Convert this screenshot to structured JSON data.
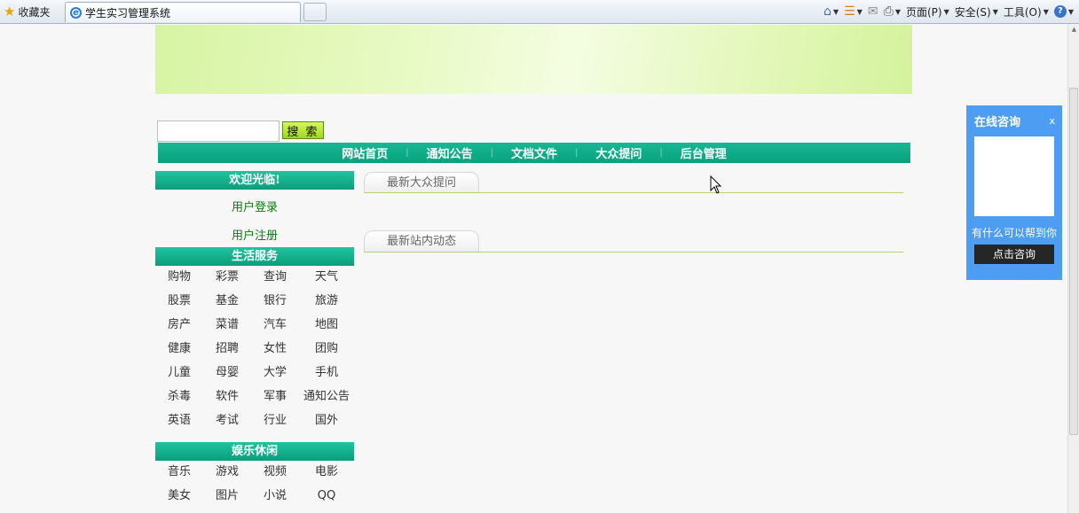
{
  "browser": {
    "favorites_label": "收藏夹",
    "tab_title": "学生实习管理系统",
    "commands": {
      "page": "页面(P)",
      "safety": "安全(S)",
      "tools": "工具(O)"
    }
  },
  "search": {
    "value": "",
    "button_label": "搜 索"
  },
  "nav": {
    "items": [
      "网站首页",
      "通知公告",
      "文档文件",
      "大众提问",
      "后台管理"
    ]
  },
  "sidebar": {
    "welcome_title": "欢迎光临!",
    "login_link": "用户登录",
    "register_link": "用户注册",
    "life_title": "生活服务",
    "life_items": [
      "购物",
      "彩票",
      "查询",
      "天气",
      "股票",
      "基金",
      "银行",
      "旅游",
      "房产",
      "菜谱",
      "汽车",
      "地图",
      "健康",
      "招聘",
      "女性",
      "团购",
      "儿童",
      "母婴",
      "大学",
      "手机",
      "杀毒",
      "软件",
      "军事",
      "通知公告",
      "英语",
      "考试",
      "行业",
      "国外"
    ],
    "fun_title": "娱乐休闲",
    "fun_items": [
      "音乐",
      "游戏",
      "视频",
      "电影",
      "美女",
      "图片",
      "小说",
      "QQ"
    ]
  },
  "main": {
    "section1_title": "最新大众提问",
    "section2_title": "最新站内动态"
  },
  "consult": {
    "title": "在线咨询",
    "close": "x",
    "prompt": "有什么可以帮到你",
    "button": "点击咨询"
  },
  "colors": {
    "nav_green": "#0aa27e",
    "link_green": "#0a7a10",
    "consult_blue": "#4d9df2",
    "rule_green": "#b6d46e"
  }
}
